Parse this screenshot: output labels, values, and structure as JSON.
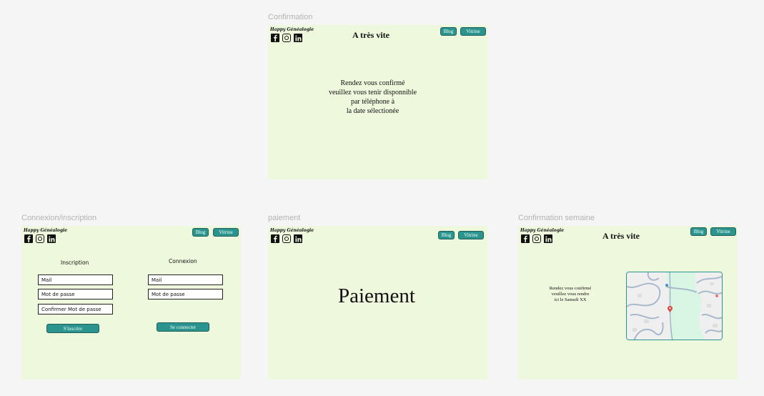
{
  "brand": {
    "logo_text": "Happy Généalogie",
    "social_icons": [
      "facebook-icon",
      "instagram-icon",
      "linkedin-icon"
    ]
  },
  "nav": {
    "blog_label": "Blog",
    "vitrine_label": "Vitrine"
  },
  "colors": {
    "canvas": "#f5f5f5",
    "frame_bg": "#eef8dc",
    "button_teal": "#2b948f",
    "button_border": "#1f5f5c",
    "frame_label": "#b3b3b3"
  },
  "frames": {
    "confirmation": {
      "label": "Confirmation",
      "title": "A très vite",
      "message_lines": [
        "Rendez vous confirmé",
        "veuillez vous tenir disponnible",
        "par téléphone à",
        "la date sélectionée"
      ]
    },
    "connexion": {
      "label": "Connexion/inscription",
      "inscription_title": "Inscription",
      "connexion_title": "Connexion",
      "mail_placeholder": "Mail",
      "password_placeholder": "Mot de passe",
      "confirm_password_placeholder": "Confirmer Mot de passe",
      "signup_button": "S'inscrire",
      "login_button": "Se connecter"
    },
    "paiement": {
      "label": "paiement",
      "heading": "Paiement"
    },
    "confirmation_semaine": {
      "label": "Confirmation semaine",
      "title": "A très vite",
      "message_lines": [
        "Rendez vous confirmé",
        "veuillez vous rendre",
        "ici le Samedi XX"
      ],
      "map_icon": "map-pin-icon"
    }
  }
}
